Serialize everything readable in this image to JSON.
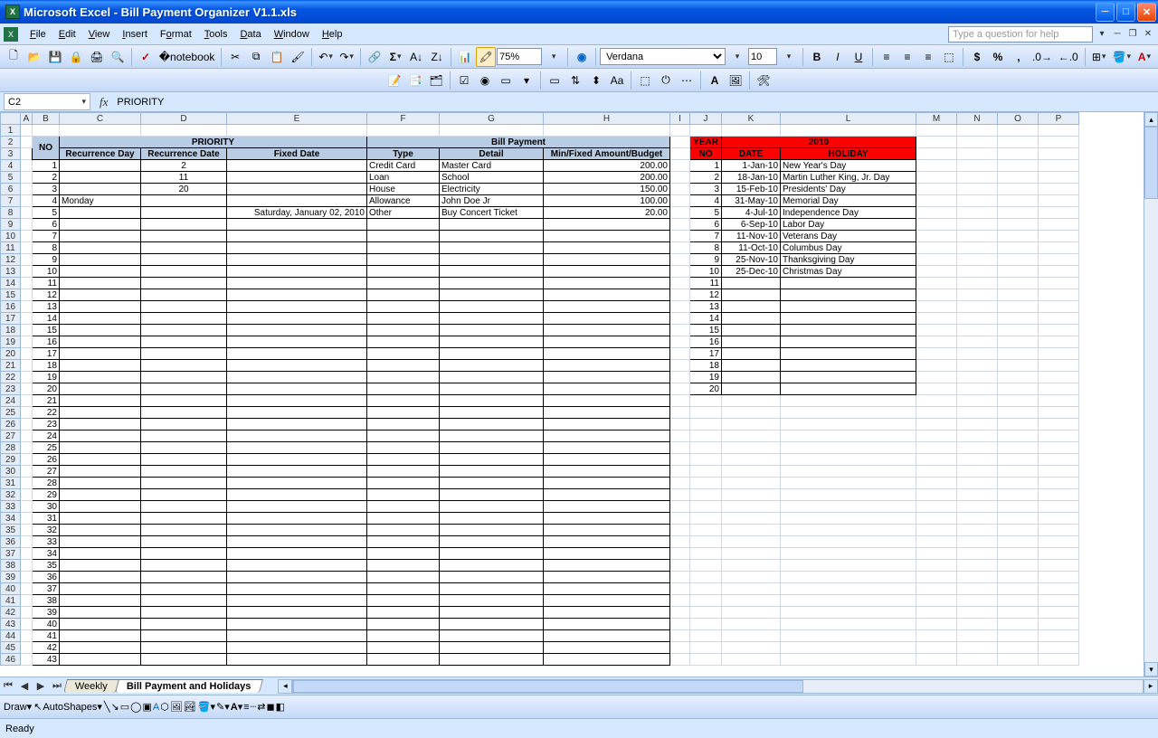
{
  "app": {
    "title": "Microsoft Excel - Bill Payment Organizer V1.1.xls"
  },
  "menu": {
    "items": [
      "File",
      "Edit",
      "View",
      "Insert",
      "Format",
      "Tools",
      "Data",
      "Window",
      "Help"
    ],
    "help_placeholder": "Type a question for help"
  },
  "toolbar": {
    "zoom": "75%",
    "font": "Verdana",
    "fontsize": "10"
  },
  "namebox": "C2",
  "formula": "PRIORITY",
  "columns": [
    "A",
    "B",
    "C",
    "D",
    "E",
    "F",
    "G",
    "H",
    "I",
    "J",
    "K",
    "L",
    "M",
    "N",
    "O",
    "P"
  ],
  "bill_header": {
    "no": "NO",
    "priority": "PRIORITY",
    "billpayment": "Bill Payment",
    "rec_day": "Recurrence Day",
    "rec_date": "Recurrence Date",
    "fixed_date": "Fixed Date",
    "type": "Type",
    "detail": "Detail",
    "amount": "Min/Fixed Amount/Budget"
  },
  "bill_rows": [
    {
      "no": "1",
      "rec_day": "",
      "rec_date": "2",
      "fixed_date": "",
      "type": "Credit Card",
      "detail": "Master Card",
      "amount": "200.00"
    },
    {
      "no": "2",
      "rec_day": "",
      "rec_date": "11",
      "fixed_date": "",
      "type": "Loan",
      "detail": "School",
      "amount": "200.00"
    },
    {
      "no": "3",
      "rec_day": "",
      "rec_date": "20",
      "fixed_date": "",
      "type": "House",
      "detail": "Electricity",
      "amount": "150.00"
    },
    {
      "no": "4",
      "rec_day": "Monday",
      "rec_date": "",
      "fixed_date": "",
      "type": "Allowance",
      "detail": "John Doe Jr",
      "amount": "100.00"
    },
    {
      "no": "5",
      "rec_day": "",
      "rec_date": "",
      "fixed_date": "Saturday, January 02, 2010",
      "type": "Other",
      "detail": "Buy Concert Ticket",
      "amount": "20.00"
    }
  ],
  "hol_header": {
    "year": "YEAR",
    "year_val": "2010",
    "no": "NO",
    "date": "DATE",
    "holiday": "HOLIDAY"
  },
  "hol_rows": [
    {
      "no": "1",
      "date": "1-Jan-10",
      "holiday": "New Year's Day"
    },
    {
      "no": "2",
      "date": "18-Jan-10",
      "holiday": "Martin Luther King, Jr. Day"
    },
    {
      "no": "3",
      "date": "15-Feb-10",
      "holiday": "Presidents' Day"
    },
    {
      "no": "4",
      "date": "31-May-10",
      "holiday": "Memorial Day"
    },
    {
      "no": "5",
      "date": "4-Jul-10",
      "holiday": "Independence Day"
    },
    {
      "no": "6",
      "date": "6-Sep-10",
      "holiday": "Labor Day"
    },
    {
      "no": "7",
      "date": "11-Nov-10",
      "holiday": "Veterans Day"
    },
    {
      "no": "8",
      "date": "11-Oct-10",
      "holiday": "Columbus Day"
    },
    {
      "no": "9",
      "date": "25-Nov-10",
      "holiday": "Thanksgiving Day"
    },
    {
      "no": "10",
      "date": "25-Dec-10",
      "holiday": "Christmas Day"
    }
  ],
  "tabs": {
    "weekly": "Weekly",
    "active": "Bill Payment and Holidays"
  },
  "draw": {
    "label": "Draw",
    "autoshapes": "AutoShapes"
  },
  "status": "Ready"
}
